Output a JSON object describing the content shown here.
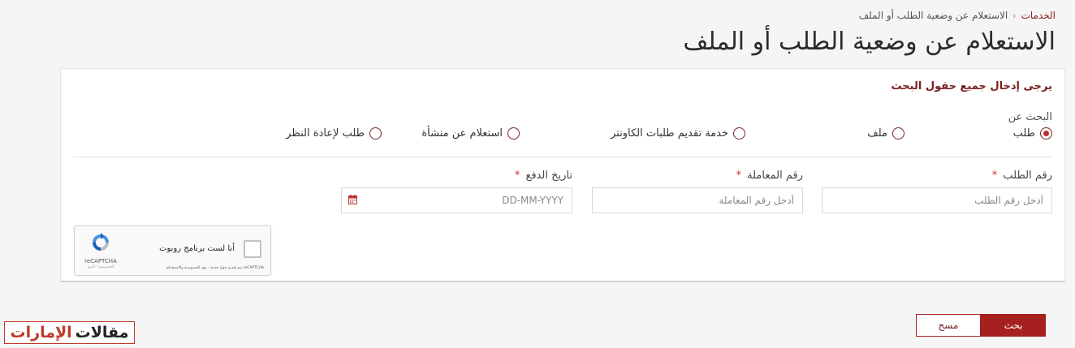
{
  "breadcrumb": {
    "items": [
      "الخدمات",
      "الاستعلام عن وضعية الطلب أو الملف"
    ],
    "separator": "‹"
  },
  "page_title": "الاستعلام عن وضعية الطلب أو الملف",
  "form": {
    "heading": "يرجى إدخال جميع حقول البحث",
    "search_by_label": "البحث عن",
    "options": [
      {
        "label": "طلب",
        "selected": true
      },
      {
        "label": "ملف",
        "selected": false
      },
      {
        "label": "خدمة تقديم طلبات الكاونتر",
        "selected": false
      },
      {
        "label": "استعلام عن منشأة",
        "selected": false
      },
      {
        "label": "طلب لإعادة النظر",
        "selected": false
      }
    ],
    "fields": {
      "request_number": {
        "label": "رقم الطلب",
        "placeholder": "أدخل رقم الطلب",
        "value": ""
      },
      "transaction_number": {
        "label": "رقم المعاملة",
        "placeholder": "أدخل رقم المعاملة",
        "value": ""
      },
      "payment_date": {
        "label": "تاريخ الدفع",
        "placeholder": "DD-MM-YYYY",
        "value": ""
      }
    },
    "required_marker": "*"
  },
  "recaptcha": {
    "label": "أنا لست برنامج روبوت",
    "brand": "reCAPTCHA",
    "footer": "reCAPTCHA يتم تقديم جولة خدمة - بنود الخصوصية والاستخدام",
    "sub": "الخصوصية - البنود"
  },
  "buttons": {
    "search": "بحث",
    "clear": "مسح"
  },
  "watermark": {
    "text_main": "مقالات",
    "text_accent": "الإمارات"
  },
  "colors": {
    "accent": "#a6201f",
    "heading": "#7a1f1f",
    "required": "#c0392b"
  },
  "icons": {
    "calendar": "calendar-icon",
    "recaptcha": "recaptcha-logo-icon"
  }
}
